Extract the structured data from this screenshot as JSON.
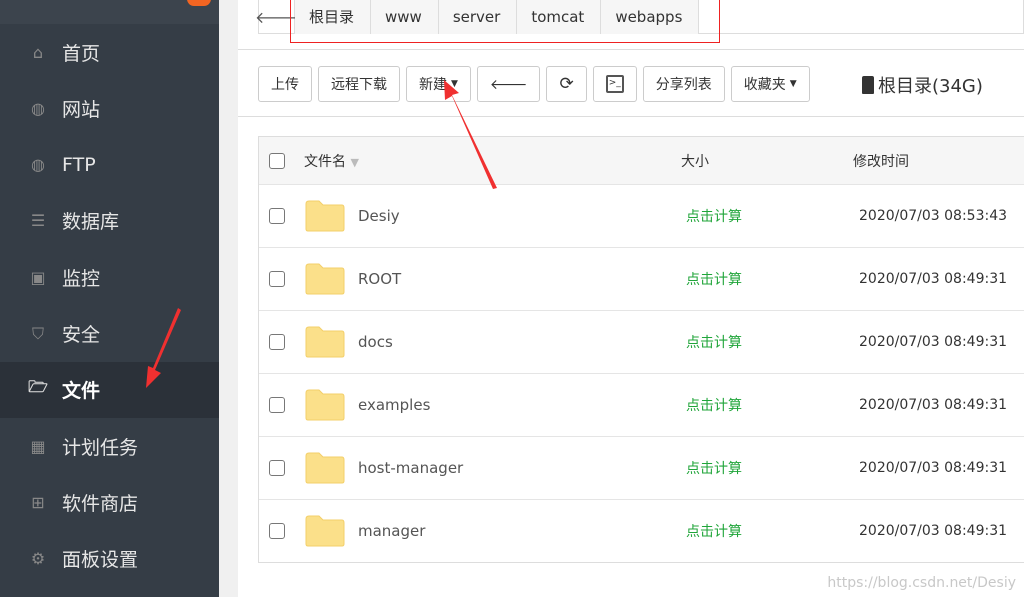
{
  "sidebar": {
    "items": [
      {
        "label": "首页",
        "icon": "home-icon",
        "glyph": "⌂"
      },
      {
        "label": "网站",
        "icon": "globe-icon",
        "glyph": "◍"
      },
      {
        "label": "FTP",
        "icon": "ftp-icon",
        "glyph": "◍"
      },
      {
        "label": "数据库",
        "icon": "database-icon",
        "glyph": "☰"
      },
      {
        "label": "监控",
        "icon": "monitor-icon",
        "glyph": "▣"
      },
      {
        "label": "安全",
        "icon": "shield-icon",
        "glyph": "⛉"
      },
      {
        "label": "文件",
        "icon": "folder-open-icon",
        "glyph": "🗁",
        "active": true
      },
      {
        "label": "计划任务",
        "icon": "calendar-icon",
        "glyph": "▦"
      },
      {
        "label": "软件商店",
        "icon": "apps-icon",
        "glyph": "⊞"
      },
      {
        "label": "面板设置",
        "icon": "gear-icon",
        "glyph": "⚙"
      }
    ]
  },
  "breadcrumb": [
    "根目录",
    "www",
    "server",
    "tomcat",
    "webapps"
  ],
  "toolbar": {
    "upload": "上传",
    "remote_download": "远程下载",
    "new": "新建",
    "share_list": "分享列表",
    "favorites": "收藏夹"
  },
  "disk": {
    "label": "根目录(34G)"
  },
  "table": {
    "headers": {
      "name": "文件名",
      "size": "大小",
      "mtime": "修改时间"
    },
    "rows": [
      {
        "name": "Desiy",
        "size": "点击计算",
        "mtime": "2020/07/03 08:53:43"
      },
      {
        "name": "ROOT",
        "size": "点击计算",
        "mtime": "2020/07/03 08:49:31"
      },
      {
        "name": "docs",
        "size": "点击计算",
        "mtime": "2020/07/03 08:49:31"
      },
      {
        "name": "examples",
        "size": "点击计算",
        "mtime": "2020/07/03 08:49:31"
      },
      {
        "name": "host-manager",
        "size": "点击计算",
        "mtime": "2020/07/03 08:49:31"
      },
      {
        "name": "manager",
        "size": "点击计算",
        "mtime": "2020/07/03 08:49:31"
      }
    ]
  },
  "watermark": "https://blog.csdn.net/Desiy",
  "colors": {
    "sidebar": "#353d46",
    "accent_green": "#20a53a",
    "annotation_red": "#e22"
  }
}
